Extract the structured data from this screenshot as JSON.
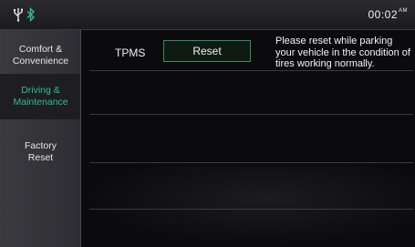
{
  "status_bar": {
    "icons": [
      "usb-icon",
      "bluetooth-icon"
    ],
    "time": "00:02",
    "ampm": "AM",
    "bluetooth_color": "#2fbf86"
  },
  "sidebar": {
    "items": [
      {
        "label": "Comfort & Convenience",
        "active": false
      },
      {
        "label": "Driving & Maintenance",
        "active": true
      },
      {
        "label": "Factory Reset",
        "active": false
      }
    ],
    "active_color": "#2fbf86"
  },
  "main": {
    "tpms_label": "TPMS",
    "reset_label": "Reset",
    "note": "Please reset while parking your vehicle in the condition of tires working normally."
  },
  "colors": {
    "accent": "#2e8f62",
    "background": "#0a0a0c"
  }
}
